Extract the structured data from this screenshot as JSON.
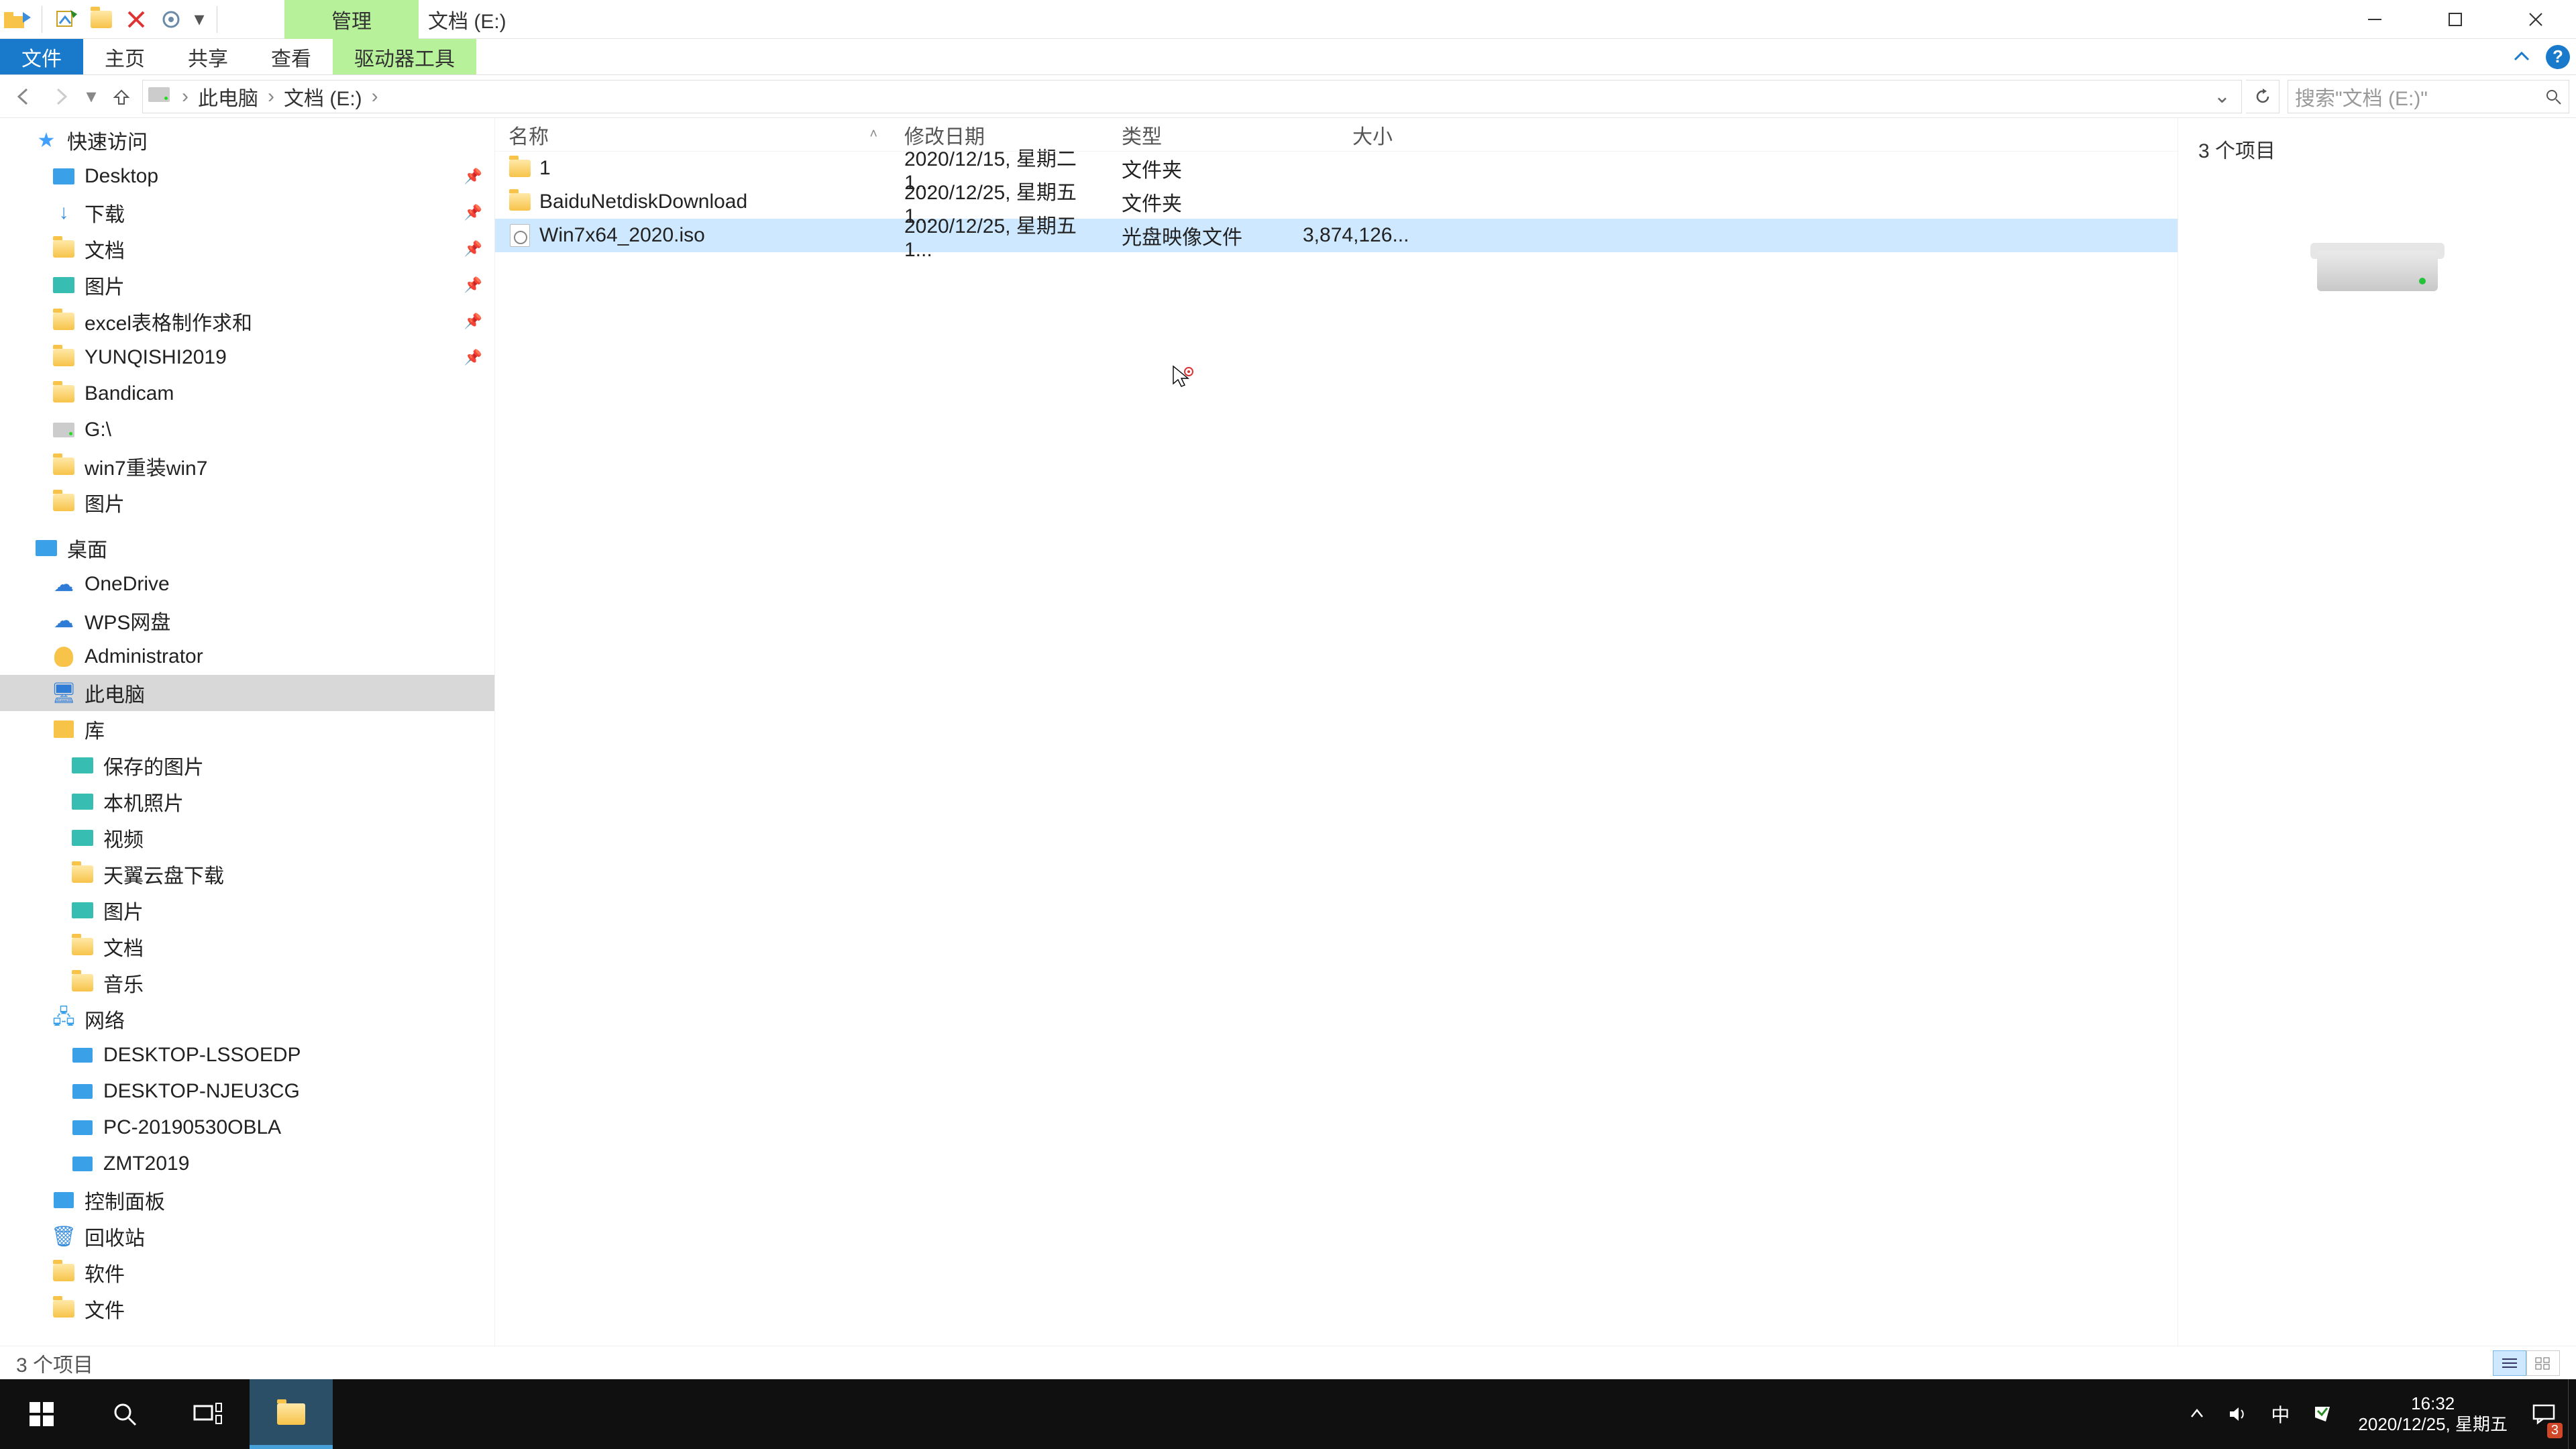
{
  "title": {
    "manage_tab": "管理",
    "window_title": "文档 (E:)"
  },
  "ribbon": {
    "file": "文件",
    "home": "主页",
    "share": "共享",
    "view": "查看",
    "drive_tools": "驱动器工具"
  },
  "address": {
    "crumbs": [
      "此电脑",
      "文档 (E:)"
    ],
    "search_placeholder": "搜索\"文档 (E:)\""
  },
  "nav": {
    "quick_access": "快速访问",
    "quick_items": [
      {
        "label": "Desktop",
        "icon": "desktop",
        "pinned": true
      },
      {
        "label": "下载",
        "icon": "dl",
        "pinned": true
      },
      {
        "label": "文档",
        "icon": "folder",
        "pinned": true
      },
      {
        "label": "图片",
        "icon": "pic",
        "pinned": true
      },
      {
        "label": "excel表格制作求和",
        "icon": "folder",
        "pinned": true
      },
      {
        "label": "YUNQISHI2019",
        "icon": "folder",
        "pinned": true
      },
      {
        "label": "Bandicam",
        "icon": "folder",
        "pinned": false
      },
      {
        "label": "G:\\",
        "icon": "disk",
        "pinned": false
      },
      {
        "label": "win7重装win7",
        "icon": "folder",
        "pinned": false
      },
      {
        "label": "图片",
        "icon": "folder",
        "pinned": false
      }
    ],
    "desktop": "桌面",
    "desktop_items": [
      {
        "label": "OneDrive",
        "icon": "onedrive"
      },
      {
        "label": "WPS网盘",
        "icon": "wps"
      },
      {
        "label": "Administrator",
        "icon": "user"
      },
      {
        "label": "此电脑",
        "icon": "pc",
        "selected": true
      },
      {
        "label": "库",
        "icon": "lib"
      }
    ],
    "lib_items": [
      {
        "label": "保存的图片",
        "icon": "pic"
      },
      {
        "label": "本机照片",
        "icon": "pic"
      },
      {
        "label": "视频",
        "icon": "pic"
      },
      {
        "label": "天翼云盘下载",
        "icon": "folder"
      },
      {
        "label": "图片",
        "icon": "pic"
      },
      {
        "label": "文档",
        "icon": "folder"
      },
      {
        "label": "音乐",
        "icon": "folder"
      }
    ],
    "network": "网络",
    "network_items": [
      {
        "label": "DESKTOP-LSSOEDP"
      },
      {
        "label": "DESKTOP-NJEU3CG"
      },
      {
        "label": "PC-20190530OBLA"
      },
      {
        "label": "ZMT2019"
      }
    ],
    "control_panel": "控制面板",
    "recycle": "回收站",
    "software": "软件",
    "docs": "文件"
  },
  "columns": {
    "name": "名称",
    "date": "修改日期",
    "type": "类型",
    "size": "大小"
  },
  "files": [
    {
      "name": "1",
      "date": "2020/12/15, 星期二 1...",
      "type": "文件夹",
      "size": "",
      "icon": "folder",
      "selected": false
    },
    {
      "name": "BaiduNetdiskDownload",
      "date": "2020/12/25, 星期五 1...",
      "type": "文件夹",
      "size": "",
      "icon": "folder",
      "selected": false
    },
    {
      "name": "Win7x64_2020.iso",
      "date": "2020/12/25, 星期五 1...",
      "type": "光盘映像文件",
      "size": "3,874,126...",
      "icon": "iso",
      "selected": true
    }
  ],
  "preview": {
    "title": "3 个项目"
  },
  "status": {
    "text": "3 个项目"
  },
  "taskbar": {
    "time": "16:32",
    "date": "2020/12/25, 星期五",
    "ime": "中",
    "notif_count": "3"
  }
}
